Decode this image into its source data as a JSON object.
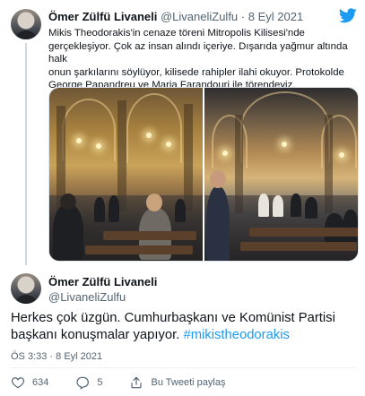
{
  "parent_tweet": {
    "display_name": "Ömer Zülfü Livaneli",
    "handle": "@LivaneliZulfu",
    "separator": "·",
    "date": "8 Eyl 2021",
    "text_lines": [
      "Mikis Theodorakis'in cenaze töreni Mitropolis Kilisesi'nde",
      "gerçekleşiyor. Çok az insan alındı içeriye. Dışarıda yağmur altında halk",
      "onun şarkılarını söylüyor, kilisede rahipler ilahi okuyor. Protokolde",
      "George Papandreu ve Maria Farandouri ile törendeyiz."
    ],
    "media": [
      "church-interior-photo-1",
      "church-interior-photo-2"
    ]
  },
  "main_tweet": {
    "display_name": "Ömer Zülfü Livaneli",
    "handle": "@LivaneliZulfu",
    "text": "Herkes çok üzgün. Cumhurbaşkanı ve Komünist Partisi başkanı konuşmalar yapıyor. ",
    "hashtag": "#mikistheodorakis",
    "time": "ÖS 3:33",
    "separator": "·",
    "date": "8 Eyl 2021"
  },
  "actions": {
    "like_count": "634",
    "reply_count": "5",
    "share_label": "Bu Tweeti paylaş"
  },
  "icons": {
    "brand": "twitter-bird-icon",
    "like": "heart-icon",
    "reply": "comment-icon",
    "share": "share-icon"
  },
  "colors": {
    "link": "#1d9bf0",
    "twitter_brand": "#1d9bf0",
    "secondary_text": "#536471"
  }
}
